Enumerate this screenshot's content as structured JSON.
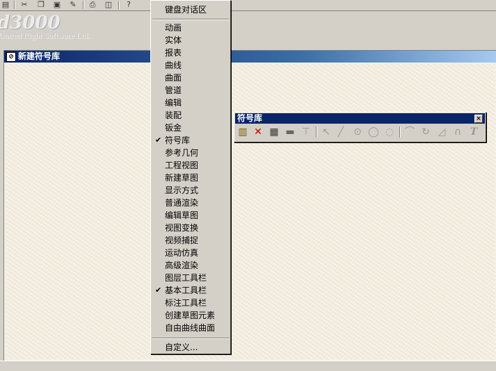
{
  "banner": {
    "logo": "d3000",
    "company": "United Right Software Ltd."
  },
  "toolbar": {
    "icons": [
      "save-icon",
      "cut-icon",
      "copy-icon",
      "paste-icon",
      "format-painter-icon",
      "print-icon",
      "print-preview-icon",
      "help-icon"
    ]
  },
  "child_window": {
    "title": "新建符号库"
  },
  "floating_toolbar": {
    "title": "符号库",
    "close": "×",
    "icons": [
      "new-symbol-icon",
      "delete-icon",
      "properties-icon",
      "block-icon",
      "line-tool-icon",
      "select-arrow-icon",
      "line-icon",
      "circle-center-icon",
      "circle-icon",
      "circle-3pt-icon",
      "arc-icon",
      "arc-rotate-icon",
      "polygon-icon",
      "curve-icon",
      "text-icon"
    ]
  },
  "menu": {
    "top_item": "键盘对话区",
    "items": [
      {
        "label": "动画",
        "checked": false
      },
      {
        "label": "实体",
        "checked": false
      },
      {
        "label": "报表",
        "checked": false
      },
      {
        "label": "曲线",
        "checked": false
      },
      {
        "label": "曲面",
        "checked": false
      },
      {
        "label": "管道",
        "checked": false
      },
      {
        "label": "编辑",
        "checked": false
      },
      {
        "label": "装配",
        "checked": false
      },
      {
        "label": "钣金",
        "checked": false
      },
      {
        "label": "符号库",
        "checked": true
      },
      {
        "label": "参考几何",
        "checked": false
      },
      {
        "label": "工程视图",
        "checked": false
      },
      {
        "label": "新建草图",
        "checked": false
      },
      {
        "label": "显示方式",
        "checked": false
      },
      {
        "label": "普通渲染",
        "checked": false
      },
      {
        "label": "编辑草图",
        "checked": false
      },
      {
        "label": "视图变换",
        "checked": false
      },
      {
        "label": "视频捕捉",
        "checked": false
      },
      {
        "label": "运动仿真",
        "checked": false
      },
      {
        "label": "高级渲染",
        "checked": false
      },
      {
        "label": "图层工具栏",
        "checked": false
      },
      {
        "label": "基本工具栏",
        "checked": true
      },
      {
        "label": "标注工具栏",
        "checked": false
      },
      {
        "label": "创建草图元素",
        "checked": false
      },
      {
        "label": "自由曲线曲面",
        "checked": false
      }
    ],
    "customize": "自定义...",
    "check_mark": "✔"
  }
}
